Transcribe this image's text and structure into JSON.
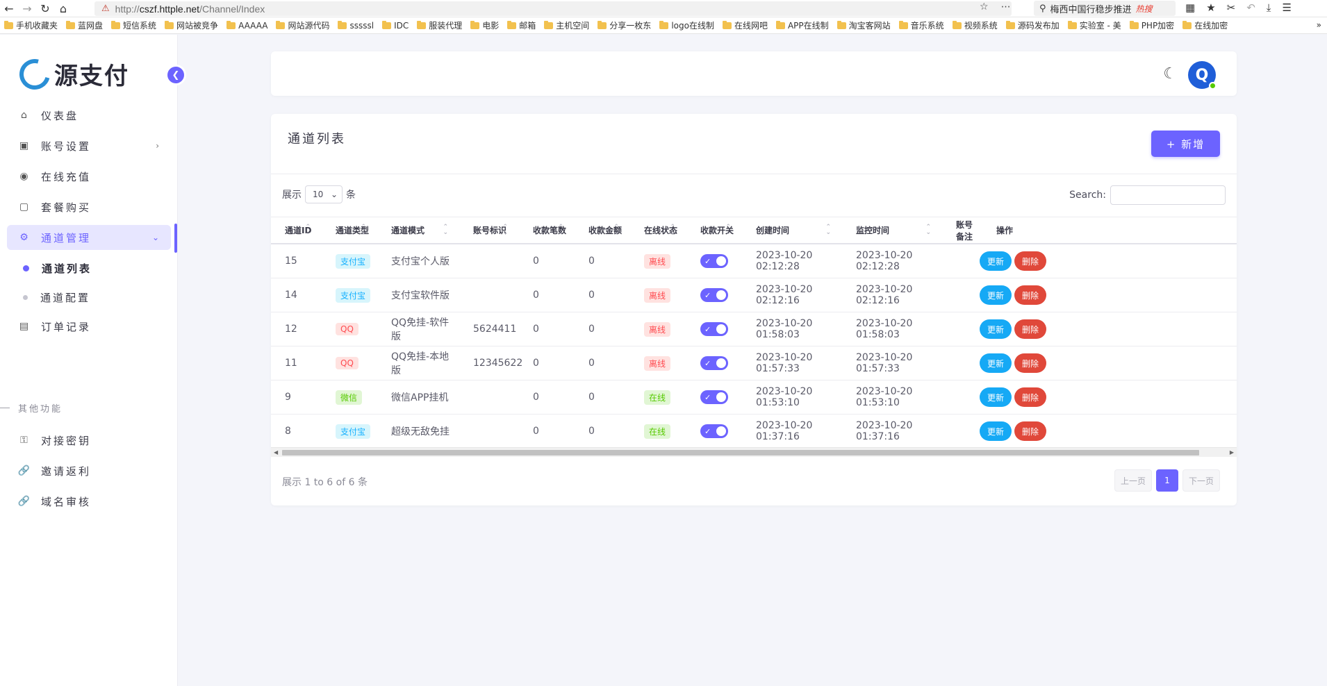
{
  "browser": {
    "url_prefix": "http://",
    "url_host": "cszf.httple.net",
    "url_path": "/Channel/Index",
    "search_text": "梅西中国行稳步推进",
    "search_engine": "热搜"
  },
  "bookmarks": [
    "手机收藏夹",
    "蓝网盘",
    "短信系统",
    "网站被竞争",
    "AAAAA",
    "网站源代码",
    "sssssl",
    "IDC",
    "服装代理",
    "电影",
    "邮箱",
    "主机空间",
    "分享一枚东",
    "logo在线制",
    "在线网吧",
    "APP在线制",
    "淘宝客网站",
    "音乐系统",
    "视频系统",
    "源码发布加",
    "实验室 - 美",
    "PHP加密",
    "在线加密"
  ],
  "sidebar": {
    "logo_text": "源支付",
    "items": [
      {
        "label": "仪表盘",
        "icon": "home-icon"
      },
      {
        "label": "账号设置",
        "icon": "account-icon"
      },
      {
        "label": "在线充值",
        "icon": "camera-icon"
      },
      {
        "label": "套餐购买",
        "icon": "bag-icon"
      },
      {
        "label": "通道管理",
        "icon": "gear-icon"
      }
    ],
    "sub_items": [
      {
        "label": "通道列表"
      },
      {
        "label": "通道配置"
      }
    ],
    "orders": {
      "label": "订单记录",
      "icon": "wallet-icon"
    },
    "section_label": "其他功能",
    "other_items": [
      {
        "label": "对接密钥",
        "icon": "key-icon"
      },
      {
        "label": "邀请返利",
        "icon": "link-icon"
      },
      {
        "label": "域名审核",
        "icon": "link-icon"
      }
    ]
  },
  "header": {
    "avatar_letter": "Q"
  },
  "main": {
    "title": "通道列表",
    "add_label": "+ 新增",
    "length_prefix": "展示",
    "length_value": "10",
    "length_suffix": "条",
    "search_label": "Search:",
    "columns": [
      "通道ID",
      "通道类型",
      "通道模式",
      "账号标识",
      "收款笔数",
      "收款金额",
      "在线状态",
      "收款开关",
      "创建时间",
      "监控时间",
      "账号备注",
      "操作"
    ],
    "rows": [
      {
        "id": "15",
        "type": "支付宝",
        "type_color": "blue",
        "mode": "支付宝个人版",
        "account": "",
        "count": "0",
        "amount": "0",
        "status": "离线",
        "status_color": "red",
        "created": "2023-10-20 02:12:28",
        "monitored": "2023-10-20 02:12:28",
        "note": ""
      },
      {
        "id": "14",
        "type": "支付宝",
        "type_color": "blue",
        "mode": "支付宝软件版",
        "account": "",
        "count": "0",
        "amount": "0",
        "status": "离线",
        "status_color": "red",
        "created": "2023-10-20 02:12:16",
        "monitored": "2023-10-20 02:12:16",
        "note": ""
      },
      {
        "id": "12",
        "type": "QQ",
        "type_color": "red",
        "mode": "QQ免挂-软件版",
        "account": "5624411",
        "count": "0",
        "amount": "0",
        "status": "离线",
        "status_color": "red",
        "created": "2023-10-20 01:58:03",
        "monitored": "2023-10-20 01:58:03",
        "note": ""
      },
      {
        "id": "11",
        "type": "QQ",
        "type_color": "red",
        "mode": "QQ免挂-本地版",
        "account": "12345622",
        "count": "0",
        "amount": "0",
        "status": "离线",
        "status_color": "red",
        "created": "2023-10-20 01:57:33",
        "monitored": "2023-10-20 01:57:33",
        "note": ""
      },
      {
        "id": "9",
        "type": "微信",
        "type_color": "green",
        "mode": "微信APP挂机",
        "account": "",
        "count": "0",
        "amount": "0",
        "status": "在线",
        "status_color": "green",
        "created": "2023-10-20 01:53:10",
        "monitored": "2023-10-20 01:53:10",
        "note": ""
      },
      {
        "id": "8",
        "type": "支付宝",
        "type_color": "blue",
        "mode": "超级无敌免挂",
        "account": "",
        "count": "0",
        "amount": "0",
        "status": "在线",
        "status_color": "green",
        "created": "2023-10-20 01:37:16",
        "monitored": "2023-10-20 01:37:16",
        "note": ""
      }
    ],
    "update_label": "更新",
    "delete_label": "删除",
    "info": "展示 1 to 6 of 6 条",
    "prev_label": "上一页",
    "current_page": "1",
    "next_label": "下一页"
  },
  "colors": {
    "accent": "#6c63ff",
    "info": "#16a9f5",
    "danger": "#e0483a"
  }
}
